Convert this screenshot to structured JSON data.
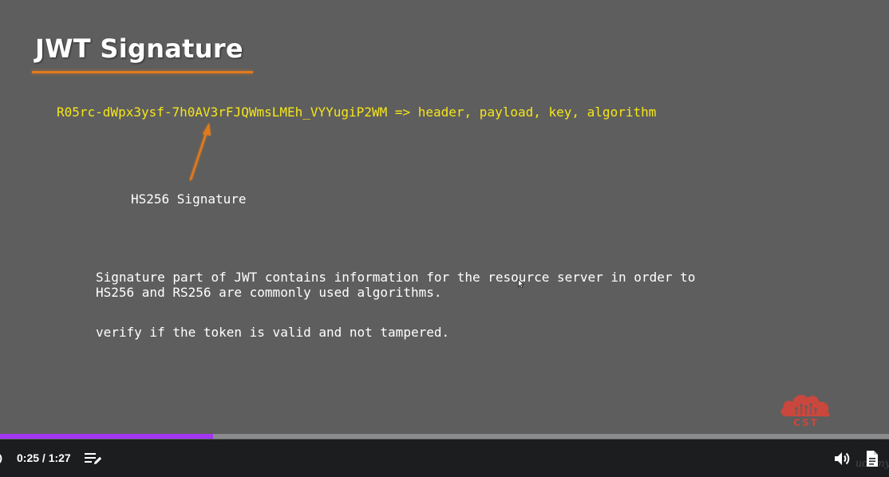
{
  "slide": {
    "title": "JWT Signature",
    "token_line": "R05rc-dWpx3ysf-7h0AV3rFJQWmsLMEh_VYYugiP2WM => header, payload, key, algorithm",
    "signature_label": "HS256 Signature",
    "description_lines": [
      "Signature part of JWT contains information for the resource server in order to",
      "verify if the token is valid and not tampered."
    ],
    "algorithms_note": "HS256 and RS256 are commonly used algorithms.",
    "logo_text": "CST",
    "colors": {
      "background": "#5e5e5e",
      "title_underline": "#e07a1f",
      "token_text": "#f5e61a",
      "arrow": "#e07a1f",
      "logo": "#c9473d"
    }
  },
  "player": {
    "progress_fraction": 0.2395,
    "progress_color": "#a435f0",
    "time_display": "0:25 / 1:27",
    "icons": {
      "left_partial": "rewind-icon",
      "transcript": "transcript-icon",
      "volume": "volume-icon",
      "notes": "notes-icon"
    }
  }
}
